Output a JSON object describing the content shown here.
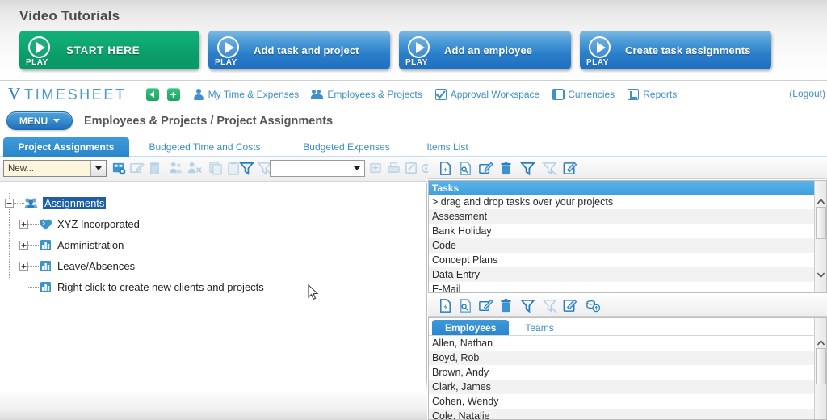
{
  "tutorials": {
    "title": "Video Tutorials",
    "play_word": "PLAY",
    "buttons": [
      {
        "label": "START HERE",
        "color": "#0fa871",
        "icon": "play-icon"
      },
      {
        "label": "Add task and project",
        "color": "#2a7fc9",
        "icon": "play-icon"
      },
      {
        "label": "Add an employee",
        "color": "#2a7fc9",
        "icon": "play-icon"
      },
      {
        "label": "Create task assignments",
        "color": "#2a7fc9",
        "icon": "play-icon"
      }
    ]
  },
  "navbar": {
    "brand_mark": "V",
    "brand_name": "TIMESHEET",
    "back_icon": "back-arrow-icon",
    "add_icon": "plus-icon",
    "links": [
      {
        "label": "My Time & Expenses",
        "icon": "person-icon"
      },
      {
        "label": "Employees & Projects",
        "icon": "people-icon"
      },
      {
        "label": "Approval Workspace",
        "icon": "checkbox-icon"
      },
      {
        "label": "Currencies",
        "icon": "currency-icon"
      },
      {
        "label": "Reports",
        "icon": "report-icon"
      }
    ],
    "logout": "(Logout)"
  },
  "menurow": {
    "menu_label": "MENU",
    "breadcrumb": "Employees & Projects / Project Assignments"
  },
  "tabs": [
    {
      "label": "Project Assignments",
      "active": true
    },
    {
      "label": "Budgeted Time and Costs",
      "active": false
    },
    {
      "label": "Budgeted Expenses",
      "active": false
    },
    {
      "label": "Items List",
      "active": false
    }
  ],
  "left_toolbar": {
    "new_select_value": "New...",
    "filter_select_value": "",
    "icons": [
      {
        "name": "new-assignment-icon",
        "enabled": true
      },
      {
        "name": "edit-icon",
        "enabled": false
      },
      {
        "name": "delete-icon",
        "enabled": false
      },
      {
        "name": "assign-employee-icon",
        "enabled": false
      },
      {
        "name": "unassign-employee-icon",
        "enabled": false
      },
      {
        "name": "copy-icon",
        "enabled": false
      },
      {
        "name": "paste-icon",
        "enabled": false
      },
      {
        "name": "filter-icon",
        "enabled": true
      },
      {
        "name": "clear-filter-icon",
        "enabled": false
      },
      {
        "name": "expand-icon",
        "enabled": false
      },
      {
        "name": "print-icon",
        "enabled": false
      },
      {
        "name": "export-icon",
        "enabled": false
      },
      {
        "name": "settings-icon",
        "enabled": false
      }
    ]
  },
  "tree": {
    "nodes": [
      {
        "label": "Assignments",
        "icon": "assignments-icon",
        "expander": "minus",
        "depth": 0,
        "selected": true
      },
      {
        "label": "XYZ Incorporated",
        "icon": "client-icon",
        "expander": "plus",
        "depth": 1,
        "selected": false
      },
      {
        "label": "Administration",
        "icon": "project-icon",
        "expander": "plus",
        "depth": 1,
        "selected": false
      },
      {
        "label": "Leave/Absences",
        "icon": "project-icon",
        "expander": "plus",
        "depth": 1,
        "selected": false
      },
      {
        "label": "Right click to create new clients and projects",
        "icon": "project-icon",
        "expander": "none",
        "depth": 1,
        "selected": false
      }
    ]
  },
  "tasks_panel": {
    "toolbar_icons": [
      {
        "name": "new-task-icon",
        "enabled": true
      },
      {
        "name": "duplicate-task-icon",
        "enabled": true
      },
      {
        "name": "edit-task-icon",
        "enabled": true
      },
      {
        "name": "delete-task-icon",
        "enabled": true
      },
      {
        "name": "filter-icon",
        "enabled": true
      },
      {
        "name": "clear-filter-icon",
        "enabled": false
      },
      {
        "name": "properties-icon",
        "enabled": true
      }
    ],
    "header": "Tasks",
    "items": [
      "> drag and drop tasks over your projects",
      "Assessment",
      "Bank Holiday",
      "Code",
      "Concept Plans",
      "Data Entry",
      "E-Mail"
    ]
  },
  "employees_panel": {
    "toolbar_icons": [
      {
        "name": "new-employee-icon",
        "enabled": true
      },
      {
        "name": "duplicate-employee-icon",
        "enabled": true
      },
      {
        "name": "edit-employee-icon",
        "enabled": true
      },
      {
        "name": "delete-employee-icon",
        "enabled": true
      },
      {
        "name": "filter-icon",
        "enabled": true
      },
      {
        "name": "clear-filter-icon",
        "enabled": false
      },
      {
        "name": "properties-icon",
        "enabled": true
      },
      {
        "name": "rates-icon",
        "enabled": true
      }
    ],
    "tabs": [
      {
        "label": "Employees",
        "active": true
      },
      {
        "label": "Teams",
        "active": false
      }
    ],
    "items": [
      "Allen, Nathan",
      "Boyd, Rob",
      "Brown, Andy",
      "Clark, James",
      "Cohen, Wendy",
      "Cole, Natalie"
    ]
  },
  "colors": {
    "accent_blue": "#2a86cc",
    "link_blue": "#3d8fc9",
    "header_blue": "#4fa8e0",
    "green": "#0fa871",
    "selection": "#1c5fa8"
  }
}
